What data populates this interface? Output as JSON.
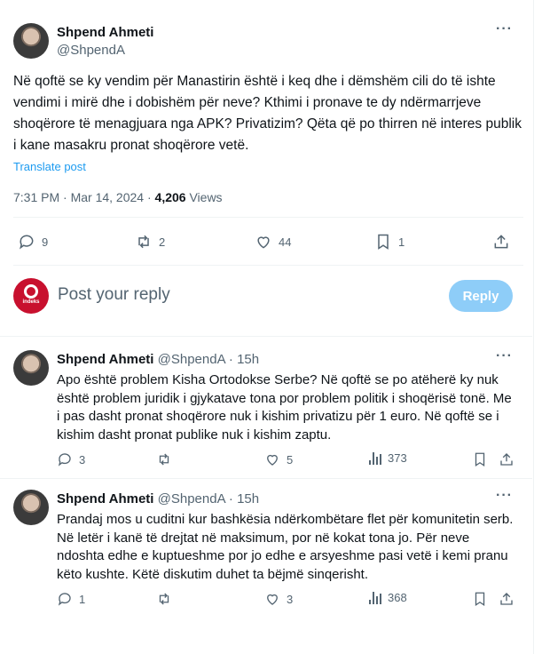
{
  "main_tweet": {
    "author_name": "Shpend Ahmeti",
    "author_handle": "@ShpendA",
    "more": "···",
    "text": "Në qoftë se ky vendim për Manastirin është i keq dhe i dëmshëm cili do të ishte vendimi i mirë dhe i dobishëm për neve? Kthimi i pronave te dy ndërmarrjeve shoqërore të menagjuara nga APK? Privatizim? Qëta që po thirren në interes publik i kane masakru pronat shoqërore vetë.",
    "translate_label": "Translate post",
    "time": "7:31 PM · Mar 14, 2024 · ",
    "views_count": "4,206",
    "views_label": " Views",
    "actions": {
      "replies": "9",
      "reposts": "2",
      "likes": "44",
      "bookmarks": "1"
    }
  },
  "reply_box": {
    "avatar_label": "indeks",
    "placeholder": "Post your reply",
    "button_label": "Reply",
    "accent": "#8ecdf8"
  },
  "replies": [
    {
      "author_name": "Shpend Ahmeti",
      "author_handle": "@ShpendA · 15h",
      "more": "···",
      "text": "Apo është problem Kisha Ortodokse Serbe? Në qoftë se po atëherë ky nuk është problem juridik i gjykatave tona por problem politik i shoqërisë tonë. Me i pas dasht pronat shoqërore nuk i kishim privatizu për 1 euro. Në qoftë se i kishim dasht pronat publike nuk i kishim zaptu.",
      "replies": "3",
      "likes": "5",
      "views": "373"
    },
    {
      "author_name": "Shpend Ahmeti",
      "author_handle": "@ShpendA · 15h",
      "more": "···",
      "text": "Prandaj mos u cuditni kur bashkësia ndërkombëtare flet për komunitetin serb. Në letër i kanë të drejtat në maksimum, por në kokat tona jo.  Për neve ndoshta edhe e kuptueshme por jo edhe e arsyeshme pasi vetë i kemi pranu këto kushte. Këtë diskutim duhet ta bëjmë sinqerisht.",
      "replies": "1",
      "likes": "3",
      "views": "368"
    }
  ],
  "colors": {
    "text": "#0f1419",
    "secondary": "#536471",
    "link": "#1d9bf0",
    "divider": "#eff3f4"
  }
}
